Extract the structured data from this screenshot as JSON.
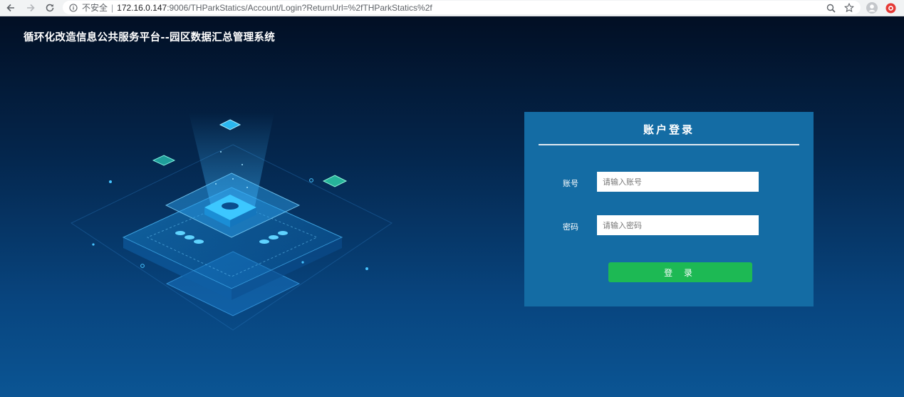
{
  "browser": {
    "insecure_label": "不安全",
    "url_host": "172.16.0.147",
    "url_path": ":9006/THParkStatics/Account/Login?ReturnUrl=%2fTHParkStatics%2f"
  },
  "page": {
    "title": "循环化改造信息公共服务平台--园区数据汇总管理系统"
  },
  "login": {
    "heading": "账户登录",
    "account_label": "账号",
    "account_placeholder": "请输入账号",
    "password_label": "密码",
    "password_placeholder": "请输入密码",
    "submit_label": "登 录"
  },
  "colors": {
    "panel": "#146ca4",
    "button": "#1db954"
  }
}
